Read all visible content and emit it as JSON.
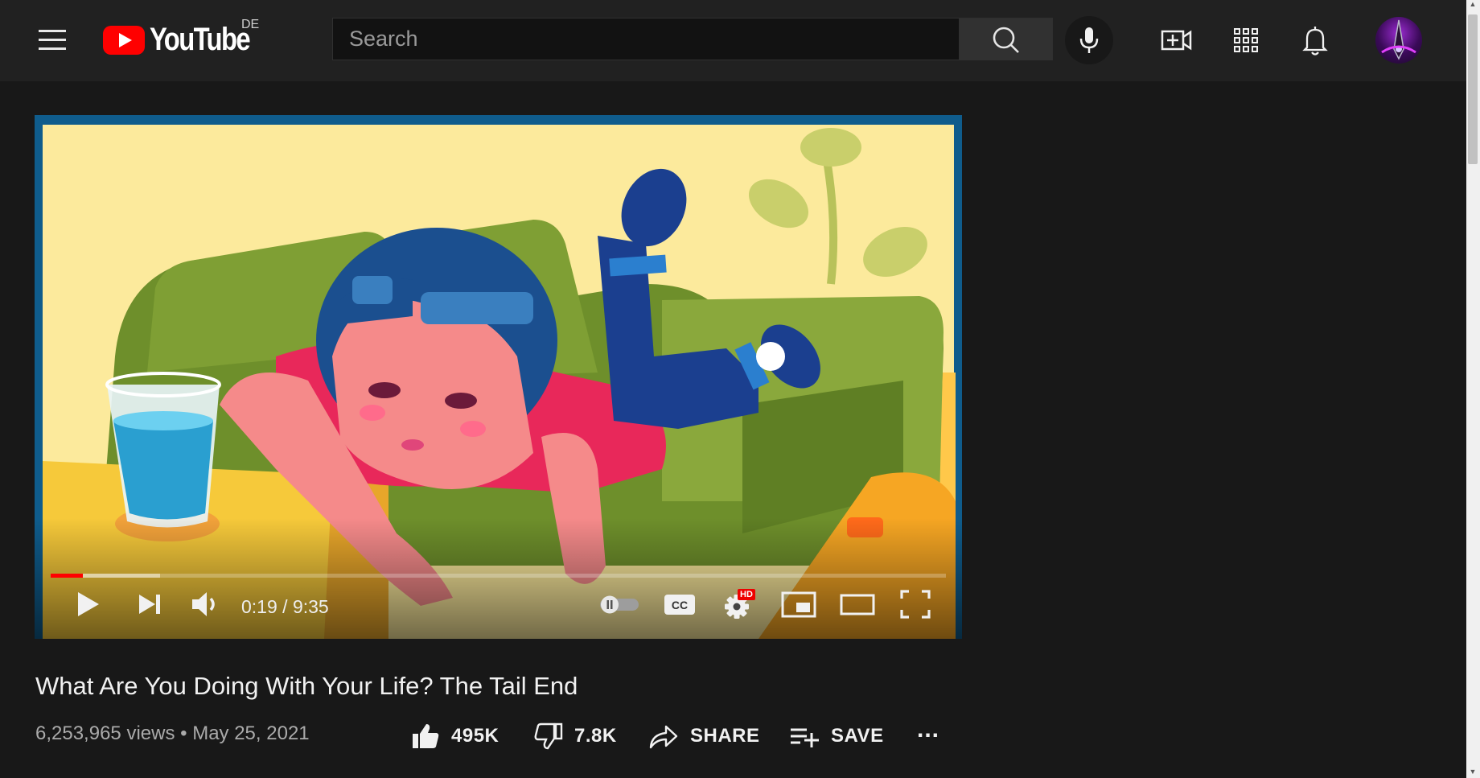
{
  "header": {
    "logo_text": "YouTube",
    "region": "DE",
    "search_placeholder": "Search",
    "icons": [
      "menu-icon",
      "search-icon",
      "mic-icon",
      "create-video-icon",
      "apps-icon",
      "bell-icon"
    ]
  },
  "player": {
    "current_time": "0:19",
    "separator": "/",
    "duration": "9:35",
    "progress_played_fraction": 0.036,
    "progress_buffered_fraction": 0.122,
    "settings_badge": "HD",
    "autoplay": "paused",
    "controls": [
      "play",
      "next",
      "volume",
      "autoplay-toggle",
      "captions",
      "settings",
      "miniplayer",
      "theater",
      "fullscreen"
    ]
  },
  "video": {
    "title": "What Are You Doing With Your Life? The Tail End",
    "views": "6,253,965 views",
    "dot": "•",
    "date": "May 25, 2021"
  },
  "actions": {
    "like_count": "495K",
    "dislike_count": "7.8K",
    "share_label": "SHARE",
    "save_label": "SAVE",
    "more_label": "..."
  },
  "colors": {
    "background": "#181818",
    "topbar": "#212121",
    "brand_red": "#ff0000",
    "progress": "#ff0000"
  }
}
